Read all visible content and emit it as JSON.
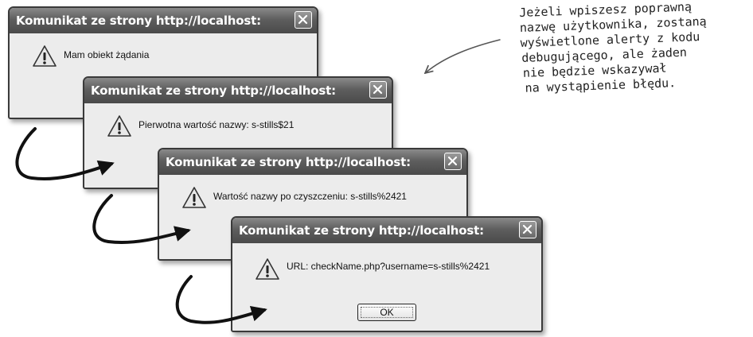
{
  "dialogs": [
    {
      "title": "Komunikat ze strony http://localhost:",
      "message": "Mam obiekt żądania"
    },
    {
      "title": "Komunikat ze strony http://localhost:",
      "message": "Pierwotna wartość nazwy: s-stills$21"
    },
    {
      "title": "Komunikat ze strony http://localhost:",
      "message": "Wartość nazwy po czyszczeniu: s-stills%2421"
    },
    {
      "title": "Komunikat ze strony http://localhost:",
      "message": "URL: checkName.php?username=s-stills%2421",
      "ok_label": "OK"
    }
  ],
  "annotation": {
    "lines": [
      "Jeżeli wpiszesz poprawną",
      "nazwę użytkownika, zostaną",
      "wyświetlone alerty z kodu",
      "debugującego, ale żaden",
      "nie będzie wskazywał",
      "na wystąpienie błędu."
    ]
  },
  "icons": {
    "warning": "warning-triangle-icon",
    "close": "close-x-icon",
    "arrow": "curved-arrow-icon"
  },
  "colors": {
    "titlebar": "#5e5e5e",
    "dialog_bg": "#ececec",
    "warning_fill": "#e8e8e8"
  }
}
